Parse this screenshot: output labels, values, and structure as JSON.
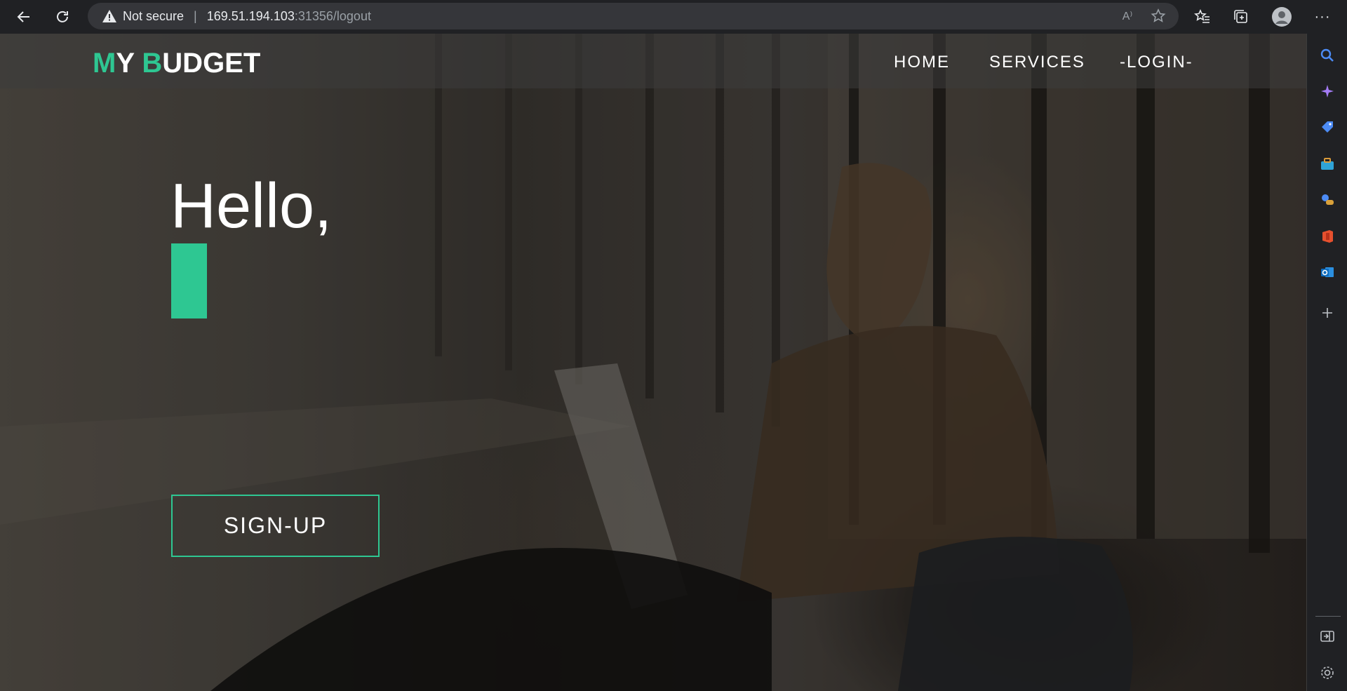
{
  "browser": {
    "security_label": "Not secure",
    "url_host": "169.51.194.103",
    "url_path": ":31356/logout"
  },
  "site": {
    "logo_m": "M",
    "logo_y": "Y ",
    "logo_b": "B",
    "logo_udget": "UDGET",
    "nav": {
      "home": "HOME",
      "services": "SERVICES",
      "login": "-LOGIN-"
    },
    "hero": {
      "greeting": "Hello,",
      "signup_label": "SIGN-UP"
    }
  },
  "colors": {
    "accent": "#2ec792",
    "chrome_bg": "#202124",
    "address_bg": "#35363a"
  },
  "icons": [
    "back-icon",
    "refresh-icon",
    "warning-icon",
    "read-aloud-icon",
    "add-favorite-icon",
    "favorites-icon",
    "collections-icon",
    "profile-icon",
    "more-icon",
    "search-icon",
    "copilot-icon",
    "shopping-tag-icon",
    "tools-icon",
    "games-icon",
    "office-icon",
    "outlook-icon",
    "add-icon",
    "split-screen-icon",
    "settings-icon"
  ]
}
